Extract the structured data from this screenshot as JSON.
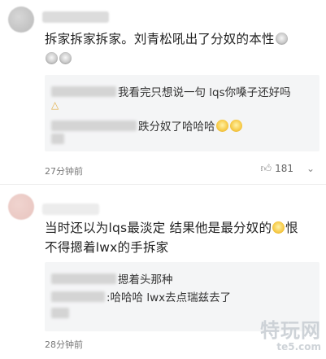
{
  "comments": [
    {
      "body": "拆家拆家拆家。刘青松吼出了分奴的本性",
      "replies": [
        {
          "text": "我看完只想说一句 lqs你嗓子还好吗",
          "extra": ""
        },
        {
          "text": "：哈哈哈",
          "extra": "跌分奴了哈哈哈"
        }
      ],
      "time": "27分钟前",
      "likes": "181"
    },
    {
      "body_line1": "当时还以为lqs最淡定 结果他是最分奴的",
      "body_line1_tail": "恨",
      "body_line2": "不得摁着lwx的手拆家",
      "replies": [
        {
          "text": "摁着头那种"
        },
        {
          "text": ":哈哈哈 lwx去点瑞兹去了"
        }
      ],
      "time": "28分钟前"
    }
  ],
  "watermark": {
    "main": "特玩网",
    "sub": "te5.com"
  },
  "icons": {
    "like": "thumbs-up-icon",
    "more": "chevron-down-icon"
  }
}
